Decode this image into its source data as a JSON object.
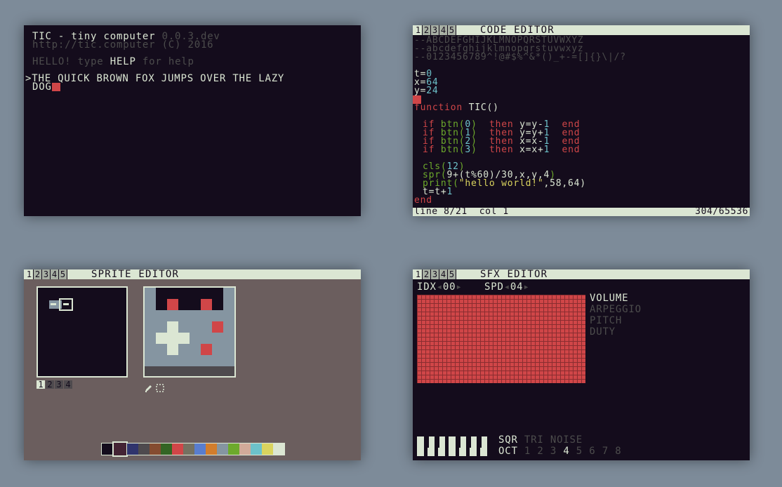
{
  "console": {
    "title": "TIC - tiny computer",
    "version": "0.0.3.dev",
    "url_line": "http://tic.computer (C) 2016",
    "hello": "HELLO!",
    "type_word": "type",
    "help": "HELP",
    "for_help": "for help",
    "prompt": ">",
    "input_line1": "THE QUICK BROWN FOX JUMPS OVER THE LAZY",
    "input_line2": "DOG"
  },
  "tabs": [
    "1",
    "2",
    "3",
    "4",
    "5"
  ],
  "code_editor": {
    "title": "CODE EDITOR",
    "comment1": "--ABCDEFGHIJKLMNOPQRSTUVWXYZ",
    "comment2": "--abcdefghijklmnopqrstuvwxyz",
    "comment3": "--0123456789^!@#$%^&*()_+-=[]{}\\|/?",
    "t_var": "t=",
    "t_val": "0",
    "x_var": "x=",
    "x_val": "64",
    "y_var": "y=",
    "y_val": "24",
    "func_kw": "function",
    "func_name": "TIC()",
    "if_lines": [
      {
        "if": "if",
        "btn": "btn(",
        "n": "0",
        "close": ")",
        "then": "then",
        "stmt": "y=y-",
        "one": "1",
        "end": "end"
      },
      {
        "if": "if",
        "btn": "btn(",
        "n": "1",
        "close": ")",
        "then": "then",
        "stmt": "y=y+",
        "one": "1",
        "end": "end"
      },
      {
        "if": "if",
        "btn": "btn(",
        "n": "2",
        "close": ")",
        "then": "then",
        "stmt": "x=x-",
        "one": "1",
        "end": "end"
      },
      {
        "if": "if",
        "btn": "btn(",
        "n": "3",
        "close": ")",
        "then": "then",
        "stmt": "x=x+",
        "one": "1",
        "end": "end"
      }
    ],
    "cls_fn": "cls(",
    "cls_arg": "12",
    "cls_close": ")",
    "spr_fn": "spr(",
    "spr_args": "9+(t%60)/30,x,y,4",
    "spr_close": ")",
    "print_fn": "print(",
    "print_str": "\"hello world!\"",
    "print_args": ",58,64)",
    "inc": "t=t+",
    "inc_one": "1",
    "end_kw": "end",
    "status_left": "line 8/21  col 1",
    "status_right": "304/65536"
  },
  "sprite_editor": {
    "title": "SPRITE EDITOR",
    "pages": [
      "1",
      "2",
      "3",
      "4"
    ],
    "palette": [
      "#140c1c",
      "#442434",
      "#30346d",
      "#4e4a4e",
      "#854c30",
      "#346524",
      "#d04648",
      "#757161",
      "#597dce",
      "#d27d2c",
      "#8595a1",
      "#6daa2c",
      "#d2aa99",
      "#6dc2ca",
      "#dad45e",
      "#dbe6d3"
    ]
  },
  "sfx_editor": {
    "title": "SFX EDITOR",
    "idx_label": "IDX",
    "idx_value": "00",
    "spd_label": "SPD",
    "spd_value": "04",
    "modes": [
      "VOLUME",
      "ARPEGGIO",
      "PITCH",
      "DUTY"
    ],
    "waves": [
      "SQR",
      "TRI",
      "NOISE"
    ],
    "oct_label": "OCT",
    "octaves": [
      "1",
      "2",
      "3",
      "4",
      "5",
      "6",
      "7",
      "8"
    ],
    "selected_octave": "4"
  }
}
